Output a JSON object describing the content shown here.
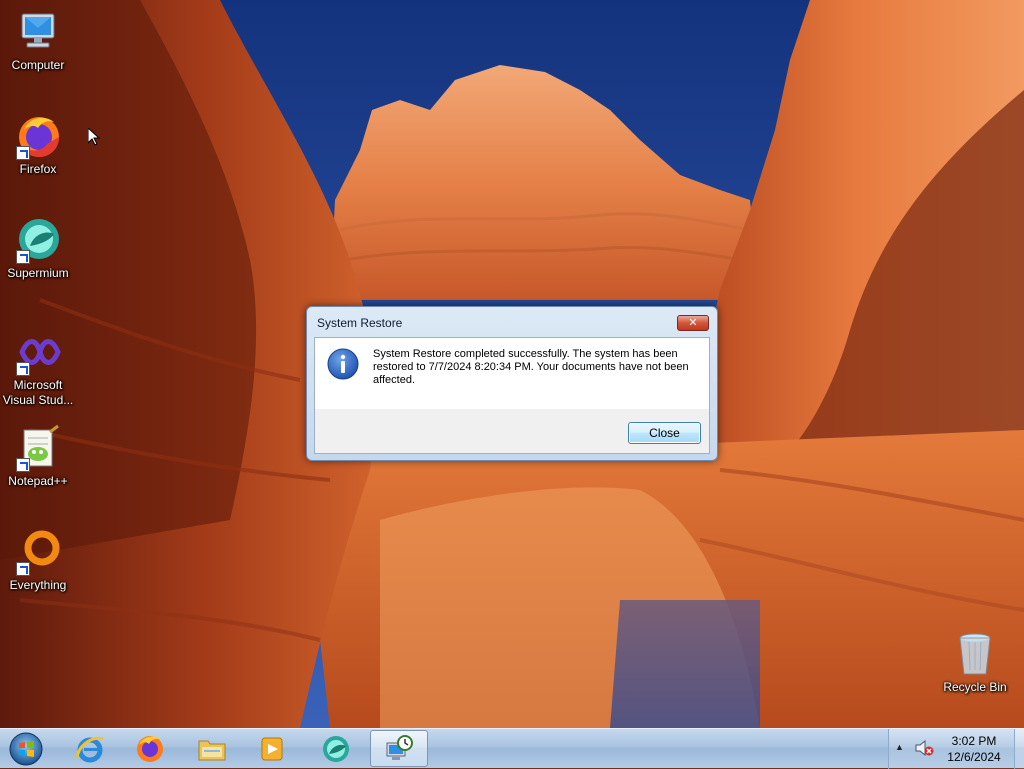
{
  "desktop": {
    "icons": [
      {
        "label": "Computer",
        "icon": "computer-icon"
      },
      {
        "label": "Firefox",
        "icon": "firefox-icon"
      },
      {
        "label": "Supermium",
        "icon": "supermium-icon"
      },
      {
        "label": "Microsoft Visual Stud...",
        "icon": "visual-studio-icon"
      },
      {
        "label": "Notepad++",
        "icon": "notepadpp-icon"
      },
      {
        "label": "Everything",
        "icon": "everything-icon"
      },
      {
        "label": "Recycle Bin",
        "icon": "recycle-bin-icon"
      }
    ]
  },
  "dialog": {
    "title": "System Restore",
    "close_glyph": "✕",
    "icon": "information-icon",
    "message": "System Restore completed successfully. The system has been restored to 7/7/2024 8:20:34 PM. Your documents have not been affected.",
    "button_label": "Close"
  },
  "taskbar": {
    "start": "start-orb-icon",
    "apps": [
      {
        "name": "Internet Explorer",
        "icon": "internet-explorer-icon"
      },
      {
        "name": "Firefox",
        "icon": "firefox-icon"
      },
      {
        "name": "Windows Explorer",
        "icon": "file-explorer-icon"
      },
      {
        "name": "Media Player",
        "icon": "media-player-icon"
      },
      {
        "name": "Supermium",
        "icon": "supermium-icon"
      },
      {
        "name": "System Restore",
        "icon": "system-restore-icon",
        "active": true
      }
    ],
    "tray": {
      "arrow": "▲",
      "volume": "volume-muted-icon",
      "time": "3:02 PM",
      "date": "12/6/2024"
    }
  },
  "colors": {
    "taskbar": "#a9c3e0",
    "dialog_frame": "#c4d8ee",
    "close_red": "#c1391c"
  }
}
